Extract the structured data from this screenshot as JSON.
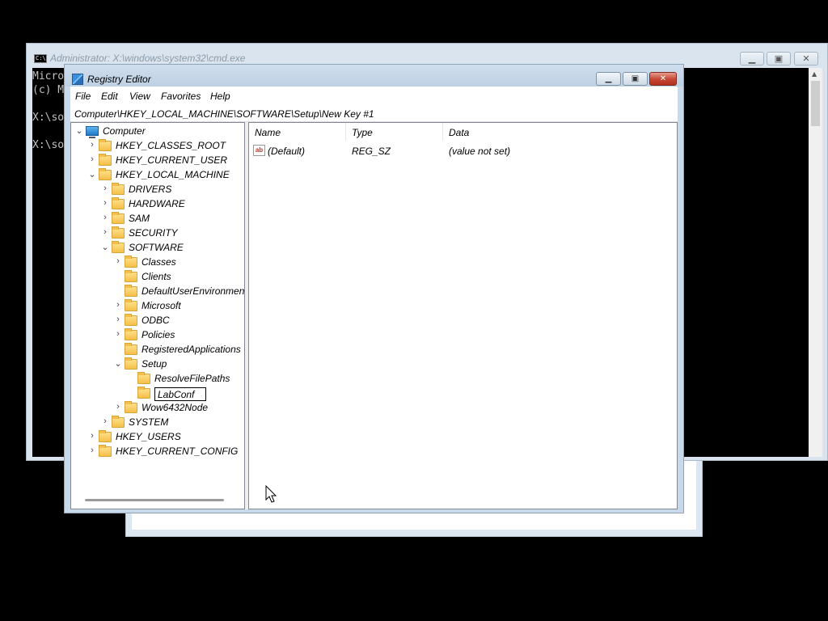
{
  "cmd": {
    "title": "Administrator: X:\\windows\\system32\\cmd.exe",
    "icon_text": "C:\\",
    "lines": [
      "Micro",
      "(c) M",
      "",
      "X:\\so",
      "",
      "X:\\so"
    ]
  },
  "regedit": {
    "title": "Registry Editor",
    "menu": [
      "File",
      "Edit",
      "View",
      "Favorites",
      "Help"
    ],
    "address": "Computer\\HKEY_LOCAL_MACHINE\\SOFTWARE\\Setup\\New Key #1",
    "tree": [
      {
        "label": "Computer",
        "chevron": "expanded",
        "icon": "computer-icon"
      },
      {
        "label": "HKEY_CLASSES_ROOT",
        "chevron": "collapsed"
      },
      {
        "label": "HKEY_CURRENT_USER",
        "chevron": "collapsed"
      },
      {
        "label": "HKEY_LOCAL_MACHINE",
        "chevron": "expanded"
      },
      {
        "label": "DRIVERS",
        "chevron": "collapsed"
      },
      {
        "label": "HARDWARE",
        "chevron": "collapsed"
      },
      {
        "label": "SAM",
        "chevron": "collapsed"
      },
      {
        "label": "SECURITY",
        "chevron": "collapsed"
      },
      {
        "label": "SOFTWARE",
        "chevron": "expanded"
      },
      {
        "label": "Classes",
        "chevron": "collapsed"
      },
      {
        "label": "Clients",
        "chevron": "none"
      },
      {
        "label": "DefaultUserEnvironmen",
        "chevron": "none"
      },
      {
        "label": "Microsoft",
        "chevron": "collapsed"
      },
      {
        "label": "ODBC",
        "chevron": "collapsed"
      },
      {
        "label": "Policies",
        "chevron": "collapsed"
      },
      {
        "label": "RegisteredApplications",
        "chevron": "none"
      },
      {
        "label": "Setup",
        "chevron": "expanded"
      },
      {
        "label": "ResolveFilePaths",
        "chevron": "none"
      },
      {
        "label": "LabConf",
        "chevron": "none",
        "editing": true
      },
      {
        "label": "Wow6432Node",
        "chevron": "collapsed"
      },
      {
        "label": "SYSTEM",
        "chevron": "collapsed"
      },
      {
        "label": "HKEY_USERS",
        "chevron": "collapsed"
      },
      {
        "label": "HKEY_CURRENT_CONFIG",
        "chevron": "collapsed"
      }
    ],
    "columns": [
      "Name",
      "Type",
      "Data"
    ],
    "values": [
      {
        "icon_text": "ab",
        "name": "(Default)",
        "type": "REG_SZ",
        "data": "(value not set)"
      }
    ]
  },
  "colors": {
    "titlebar": "#c9d9ea",
    "close_button": "#c54532",
    "folder": "#f4c04a"
  }
}
